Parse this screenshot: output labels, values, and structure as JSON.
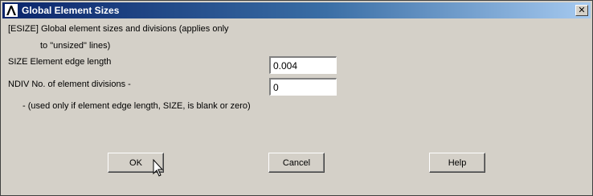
{
  "window": {
    "title": "Global Element Sizes",
    "close_glyph": "✕"
  },
  "dialog": {
    "esize_line1": "[ESIZE]  Global element sizes and divisions (applies only",
    "esize_line2": "to \"unsized\" lines)",
    "size_label": "SIZE  Element edge length",
    "size_value": "0.004",
    "ndiv_label": "NDIV  No. of element divisions -",
    "ndiv_value": "0",
    "note": "- (used only if element edge length, SIZE, is blank or zero)"
  },
  "buttons": {
    "ok": "OK",
    "cancel": "Cancel",
    "help": "Help"
  },
  "icons": {
    "app": "ansys-logo-icon",
    "close": "close-icon",
    "cursor": "mouse-pointer-icon"
  }
}
